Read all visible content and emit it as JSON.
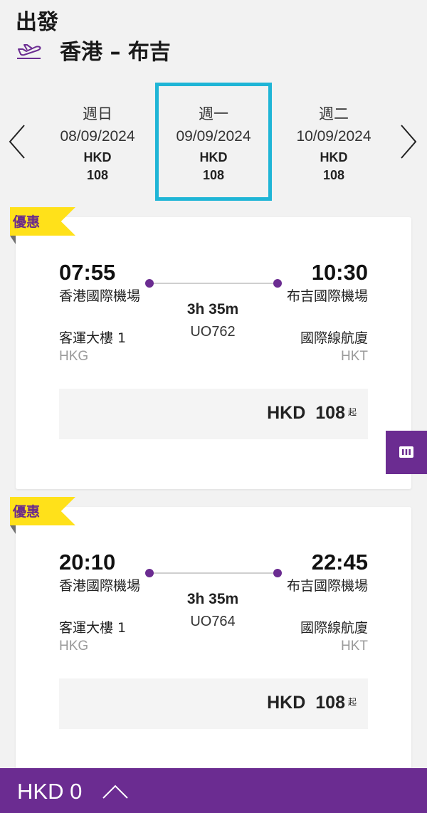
{
  "header": {
    "title": "出發",
    "route": "香港 – 布吉"
  },
  "date_selector": {
    "dates": [
      {
        "day": "週日",
        "date": "08/09/2024",
        "currency": "HKD",
        "price": "108",
        "selected": false
      },
      {
        "day": "週一",
        "date": "09/09/2024",
        "currency": "HKD",
        "price": "108",
        "selected": true
      },
      {
        "day": "週二",
        "date": "10/09/2024",
        "currency": "HKD",
        "price": "108",
        "selected": false
      }
    ],
    "accent_color": "#1fb5d6"
  },
  "flights": [
    {
      "badge": "優惠",
      "dep_time": "07:55",
      "dep_airport": "香港國際機場",
      "dep_terminal": "客運大樓 1",
      "dep_code": "HKG",
      "arr_time": "10:30",
      "arr_airport": "布吉國際機場",
      "arr_terminal": "國際線航廈",
      "arr_code": "HKT",
      "duration": "3h 35m",
      "flight_no": "UO762",
      "fare_currency": "HKD",
      "fare_amount": "108",
      "fare_suffix": "起"
    },
    {
      "badge": "優惠",
      "dep_time": "20:10",
      "dep_airport": "香港國際機場",
      "dep_terminal": "客運大樓 1",
      "dep_code": "HKG",
      "arr_time": "22:45",
      "arr_airport": "布吉國際機場",
      "arr_terminal": "國際線航廈",
      "arr_code": "HKT",
      "duration": "3h 35m",
      "flight_no": "UO764",
      "fare_currency": "HKD",
      "fare_amount": "108",
      "fare_suffix": "起"
    }
  ],
  "bottom_bar": {
    "total": "HKD 0"
  },
  "icons": {
    "departure": "plane-takeoff-icon",
    "prev": "chevron-left-icon",
    "next": "chevron-right-icon",
    "side": "calendar-icon",
    "expand": "chevron-up-icon"
  },
  "colors": {
    "brand_purple": "#6b2c91",
    "promo_yellow": "#ffe11a"
  }
}
